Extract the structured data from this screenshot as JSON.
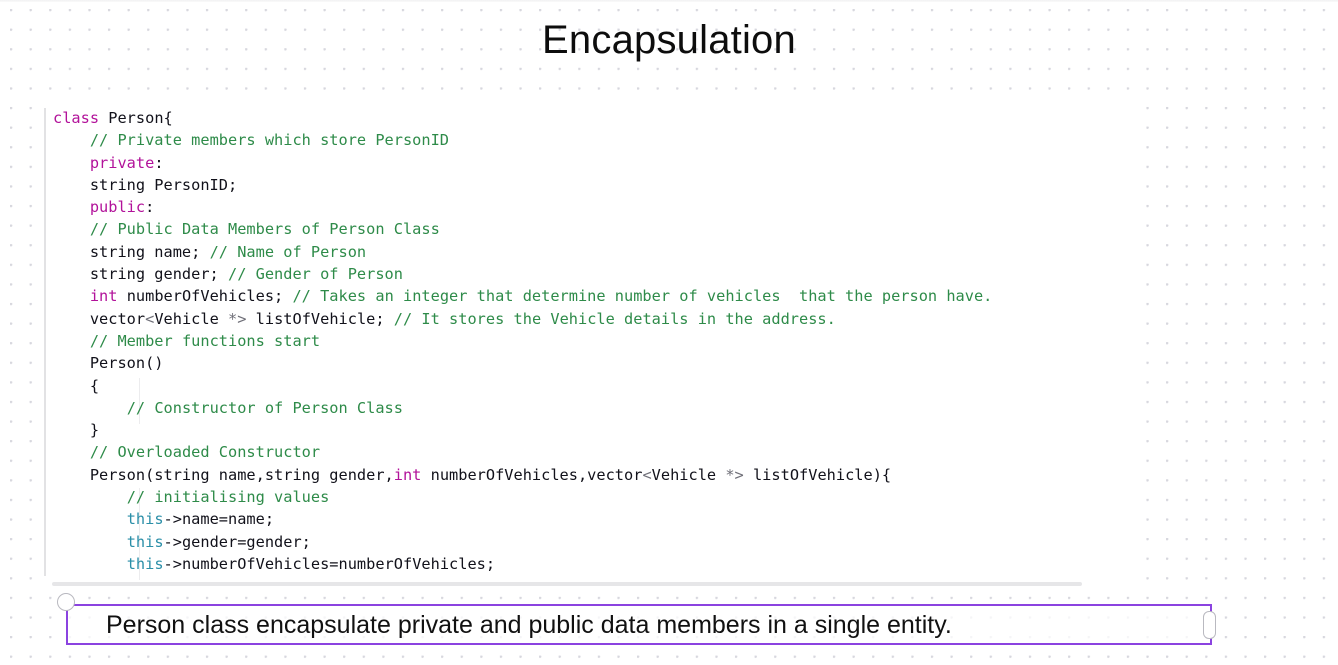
{
  "slide": {
    "title": "Encapsulation"
  },
  "code_block": {
    "language": "cpp",
    "scrollbar": {
      "orientation": "horizontal"
    },
    "lines": [
      [
        {
          "t": "class ",
          "c": "kw"
        },
        {
          "t": "Person{",
          "c": "plain"
        }
      ],
      [
        {
          "t": "    ",
          "c": "plain"
        },
        {
          "t": "// Private members which store PersonID",
          "c": "cmt"
        }
      ],
      [
        {
          "t": "    ",
          "c": "plain"
        },
        {
          "t": "private",
          "c": "kw"
        },
        {
          "t": ":",
          "c": "plain"
        }
      ],
      [
        {
          "t": "    string PersonID;",
          "c": "plain"
        }
      ],
      [
        {
          "t": "    ",
          "c": "plain"
        },
        {
          "t": "public",
          "c": "kw"
        },
        {
          "t": ":",
          "c": "plain"
        }
      ],
      [
        {
          "t": "    ",
          "c": "plain"
        },
        {
          "t": "// Public Data Members of Person Class",
          "c": "cmt"
        }
      ],
      [
        {
          "t": "    string name; ",
          "c": "plain"
        },
        {
          "t": "// Name of Person",
          "c": "cmt"
        }
      ],
      [
        {
          "t": "    string gender; ",
          "c": "plain"
        },
        {
          "t": "// Gender of Person",
          "c": "cmt"
        }
      ],
      [
        {
          "t": "    ",
          "c": "plain"
        },
        {
          "t": "int",
          "c": "kw"
        },
        {
          "t": " numberOfVehicles; ",
          "c": "plain"
        },
        {
          "t": "// Takes an integer that determine number of vehicles  that the person have.",
          "c": "cmt"
        }
      ],
      [
        {
          "t": "    vector",
          "c": "plain"
        },
        {
          "t": "<",
          "c": "punct"
        },
        {
          "t": "Vehicle ",
          "c": "plain"
        },
        {
          "t": "*>",
          "c": "punct"
        },
        {
          "t": " listOfVehicle; ",
          "c": "plain"
        },
        {
          "t": "// It stores the Vehicle details in the address.",
          "c": "cmt"
        }
      ],
      [
        {
          "t": "    ",
          "c": "plain"
        },
        {
          "t": "// Member functions start",
          "c": "cmt"
        }
      ],
      [
        {
          "t": "    Person()",
          "c": "plain"
        }
      ],
      [
        {
          "t": "    {",
          "c": "plain"
        }
      ],
      [
        {
          "t": "        ",
          "c": "plain"
        },
        {
          "t": "// Constructor of Person Class",
          "c": "cmt"
        }
      ],
      [
        {
          "t": "    }",
          "c": "plain"
        }
      ],
      [
        {
          "t": "    ",
          "c": "plain"
        },
        {
          "t": "// Overloaded Constructor",
          "c": "cmt"
        }
      ],
      [
        {
          "t": "    Person(string name,string gender,",
          "c": "plain"
        },
        {
          "t": "int",
          "c": "kw"
        },
        {
          "t": " numberOfVehicles,vector",
          "c": "plain"
        },
        {
          "t": "<",
          "c": "punct"
        },
        {
          "t": "Vehicle ",
          "c": "plain"
        },
        {
          "t": "*>",
          "c": "punct"
        },
        {
          "t": " listOfVehicle){",
          "c": "plain"
        }
      ],
      [
        {
          "t": "        ",
          "c": "plain"
        },
        {
          "t": "// initialising values",
          "c": "cmt"
        }
      ],
      [
        {
          "t": "        ",
          "c": "plain"
        },
        {
          "t": "this",
          "c": "this"
        },
        {
          "t": "->name=name;",
          "c": "plain"
        }
      ],
      [
        {
          "t": "        ",
          "c": "plain"
        },
        {
          "t": "this",
          "c": "this"
        },
        {
          "t": "->gender=gender;",
          "c": "plain"
        }
      ],
      [
        {
          "t": "        ",
          "c": "plain"
        },
        {
          "t": "this",
          "c": "this"
        },
        {
          "t": "->numberOfVehicles=numberOfVehicles;",
          "c": "plain"
        }
      ]
    ]
  },
  "caption": {
    "text": "Person class encapsulate private and public data members in a single entity.",
    "border_color": "#8b43e0",
    "handles": {
      "rotate": "rotate-handle",
      "resize_right": "resize-handle-right"
    }
  },
  "colors": {
    "keyword": "#b2129a",
    "comment": "#2e8b49",
    "this_keyword": "#2b8fa8",
    "plain_text": "#11111a",
    "punctuation": "#6f6f78",
    "caption_border": "#8b43e0",
    "grid_dot": "#d7d7de"
  }
}
